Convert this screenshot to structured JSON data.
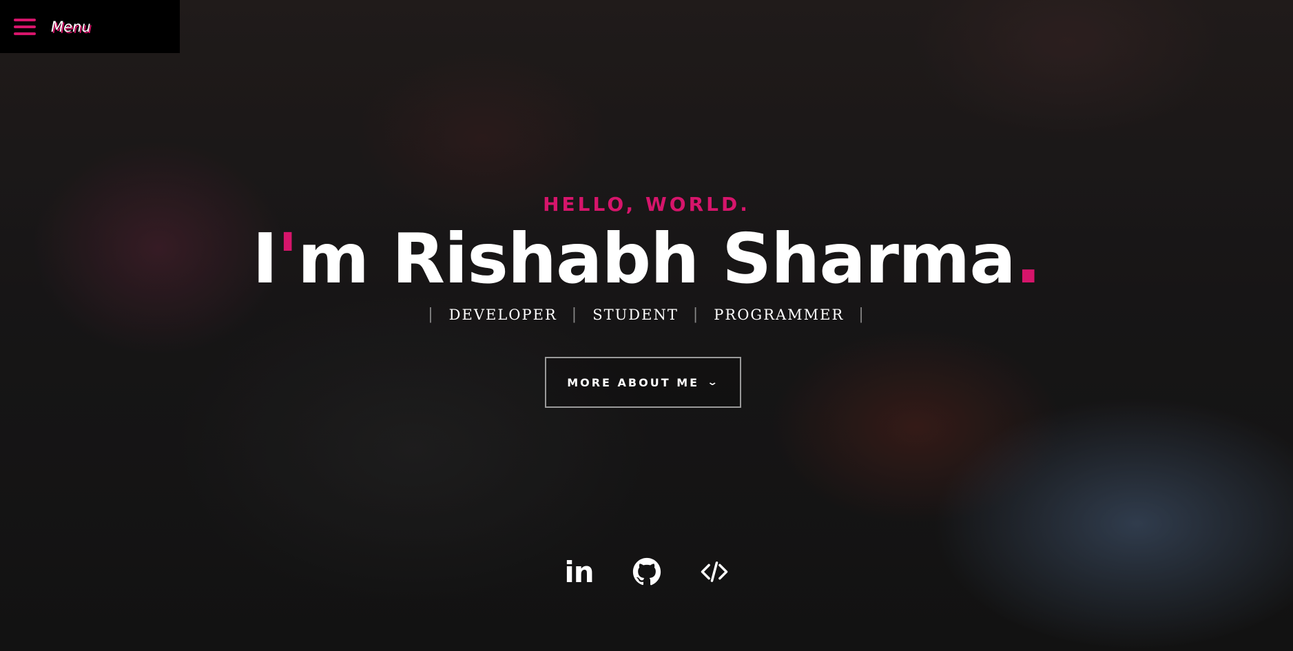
{
  "menu": {
    "label": "Menu",
    "icon": "hamburger-icon",
    "accent": "#d6156b"
  },
  "hero": {
    "greeting": "HELLO, WORLD.",
    "name_apostrophe_prefix": "I",
    "name_apostrophe": "'",
    "name_rest": "m Rishabh Sharma",
    "name_dot": ".",
    "roles": [
      "DEVELOPER",
      "STUDENT",
      "PROGRAMMER"
    ],
    "separator": "|",
    "cta_label": "MORE ABOUT ME",
    "cta_icon": "chevron-down-icon"
  },
  "socials": [
    {
      "name": "linkedin-icon",
      "text": "in"
    },
    {
      "name": "github-icon"
    },
    {
      "name": "code-icon"
    }
  ],
  "colors": {
    "accent": "#d6156b",
    "text": "#ffffff",
    "menu_bg": "#000000"
  }
}
